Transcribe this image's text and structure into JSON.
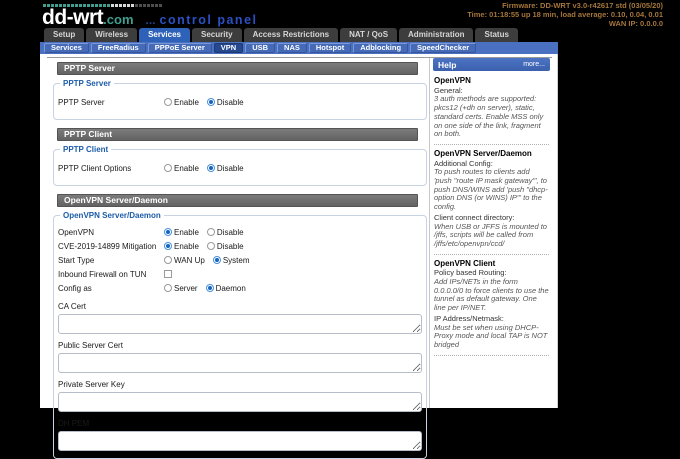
{
  "colors": {
    "accent_blue": "#2d62b8",
    "brand_teal": "#3f9e8e",
    "firmware_text": "#a5763c"
  },
  "header": {
    "brand": "dd-wrt",
    "brand_suffix": ".com",
    "brand_dots": "...",
    "subtitle": "control panel",
    "firmware_line": "Firmware: DD-WRT v3.0-r42617 std (03/05/20)",
    "time_line": "Time: 01:18:55 up 18 min, load average: 0.10, 0.04, 0.01",
    "wan_line": "WAN IP: 0.0.0.0"
  },
  "nav": {
    "tabs": [
      {
        "label": "Setup",
        "active": false
      },
      {
        "label": "Wireless",
        "active": false
      },
      {
        "label": "Services",
        "active": true
      },
      {
        "label": "Security",
        "active": false
      },
      {
        "label": "Access Restrictions",
        "active": false
      },
      {
        "label": "NAT / QoS",
        "active": false
      },
      {
        "label": "Administration",
        "active": false
      },
      {
        "label": "Status",
        "active": false
      }
    ],
    "subtabs": [
      {
        "label": "Services",
        "active": false
      },
      {
        "label": "FreeRadius",
        "active": false
      },
      {
        "label": "PPPoE Server",
        "active": false
      },
      {
        "label": "VPN",
        "active": true
      },
      {
        "label": "USB",
        "active": false
      },
      {
        "label": "NAS",
        "active": false
      },
      {
        "label": "Hotspot",
        "active": false
      },
      {
        "label": "Adblocking",
        "active": false
      },
      {
        "label": "SpeedChecker",
        "active": false
      }
    ]
  },
  "sections": [
    {
      "title": "PPTP Server",
      "legend": "PPTP Server",
      "rows": [
        {
          "label": "PPTP Server",
          "options": [
            {
              "label": "Enable",
              "checked": false
            },
            {
              "label": "Disable",
              "checked": true
            }
          ]
        }
      ]
    },
    {
      "title": "PPTP Client",
      "legend": "PPTP Client",
      "rows": [
        {
          "label": "PPTP Client Options",
          "options": [
            {
              "label": "Enable",
              "checked": false
            },
            {
              "label": "Disable",
              "checked": true
            }
          ]
        }
      ]
    },
    {
      "title": "OpenVPN Server/Daemon",
      "legend": "OpenVPN Server/Daemon",
      "rows": [
        {
          "label": "OpenVPN",
          "options": [
            {
              "label": "Enable",
              "checked": true
            },
            {
              "label": "Disable",
              "checked": false
            }
          ]
        },
        {
          "label": "CVE-2019-14899 Mitigation",
          "options": [
            {
              "label": "Enable",
              "checked": true
            },
            {
              "label": "Disable",
              "checked": false
            }
          ]
        },
        {
          "label": "Start Type",
          "options": [
            {
              "label": "WAN Up",
              "checked": false
            },
            {
              "label": "System",
              "checked": true
            }
          ]
        },
        {
          "label": "Inbound Firewall on TUN",
          "checkbox": {
            "checked": false
          }
        },
        {
          "label": "Config as",
          "options": [
            {
              "label": "Server",
              "checked": false
            },
            {
              "label": "Daemon",
              "checked": true
            }
          ]
        }
      ],
      "textareas": [
        {
          "label": "CA Cert",
          "value": ""
        },
        {
          "label": "Public Server Cert",
          "value": ""
        },
        {
          "label": "Private Server Key",
          "value": ""
        },
        {
          "label": "DH PEM",
          "value": ""
        }
      ]
    }
  ],
  "help": {
    "title": "Help",
    "more_label": "more...",
    "blocks": [
      {
        "heading": "OpenVPN",
        "items": [
          {
            "label": "General:",
            "text": "3 auth methods are supported: pkcs12 (+dh on server), static, standard certs. Enable MSS only on one side of the link, fragment on both."
          }
        ]
      },
      {
        "heading": "OpenVPN Server/Daemon",
        "items": [
          {
            "label": "Additional Config:",
            "text": "To push routes to clients add 'push \"route IP mask gateway\"', to push DNS/WINS add 'push \"dhcp-option DNS (or WINS) IP\"' to the config."
          },
          {
            "label": "Client connect directory:",
            "text": "When USB or JFFS is mounted to /jffs, scripts will be called from /jffs/etc/openvpn/ccd/"
          }
        ]
      },
      {
        "heading": "OpenVPN Client",
        "items": [
          {
            "label": "Policy based Routing:",
            "text": "Add IPs/NETs in the form 0.0.0.0/0 to force clients to use the tunnel as default gateway. One line per IP/NET."
          },
          {
            "label": "IP Address/Netmask:",
            "text": "Must be set when using DHCP-Proxy mode and local TAP is NOT bridged"
          }
        ]
      }
    ]
  }
}
